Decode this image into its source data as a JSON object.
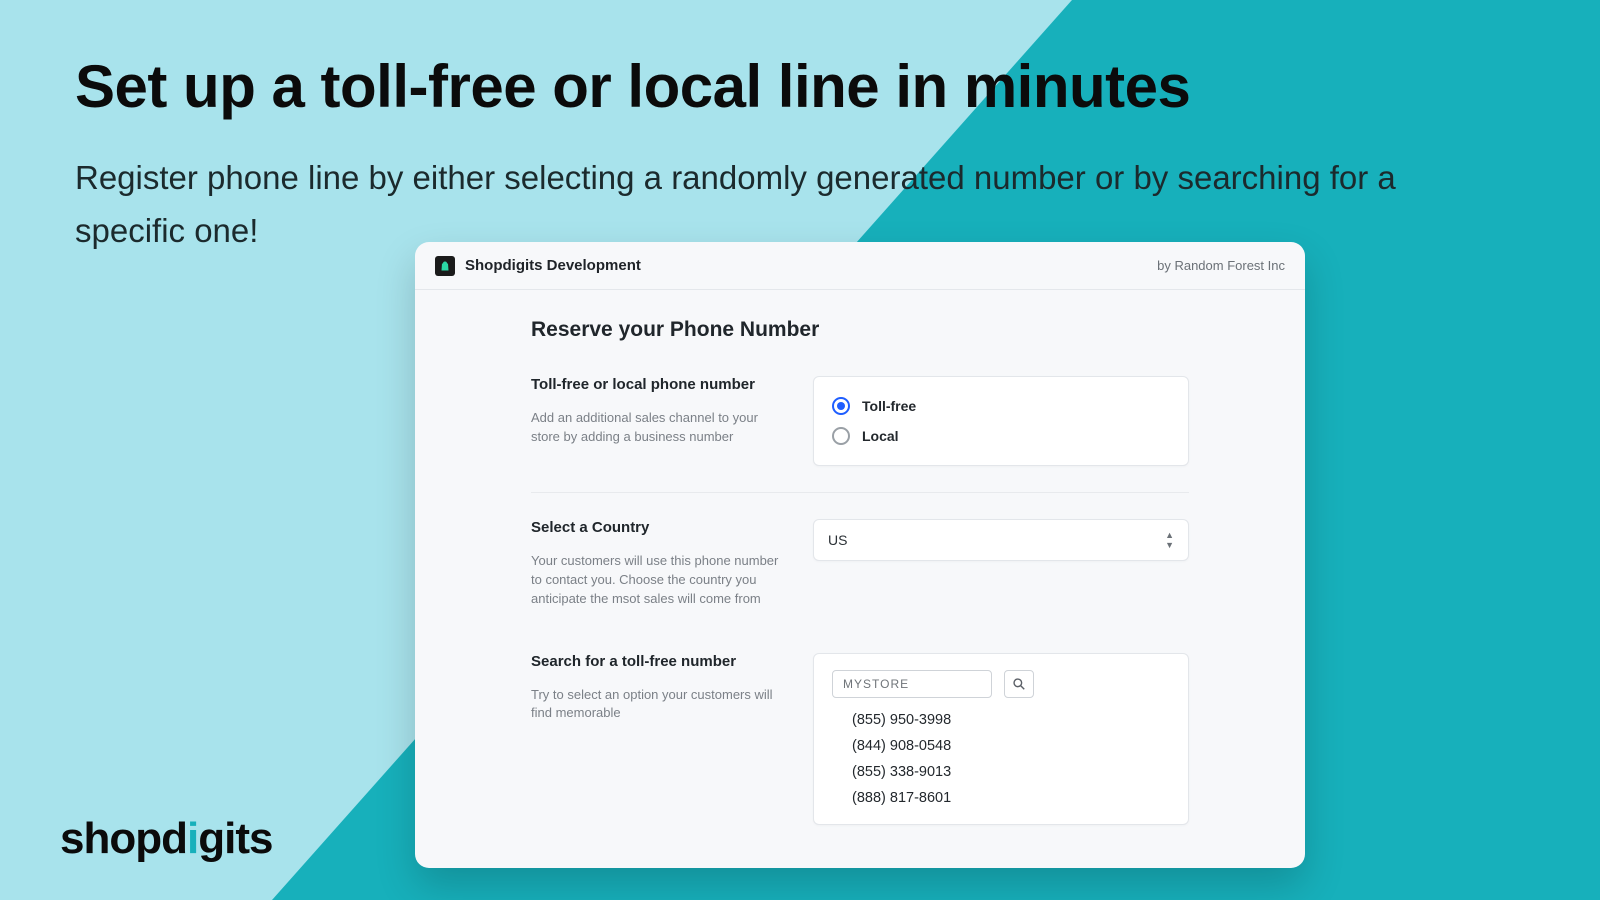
{
  "hero": {
    "headline": "Set up a toll-free or local line in minutes",
    "subhead": "Register phone line by either selecting a randomly generated number or by searching for a specific one!"
  },
  "brand": {
    "pre": "shopd",
    "accent": "i",
    "post": "gits"
  },
  "panel": {
    "app_title": "Shopdigits Development",
    "by_line": "by Random Forest Inc",
    "page_title": "Reserve your Phone Number",
    "type_section": {
      "title": "Toll-free or local phone number",
      "desc": "Add an additional sales channel to your store by adding a business number",
      "options": {
        "toll_free": "Toll-free",
        "local": "Local"
      }
    },
    "country_section": {
      "title": "Select a Country",
      "desc": "Your customers will use this phone number to contact you. Choose the country you anticipate the msot sales will come from",
      "value": "US"
    },
    "search_section": {
      "title": "Search for a toll-free number",
      "desc": "Try to select an option your customers will find memorable",
      "input_value": "MYSTORE",
      "results": [
        "(855) 950-3998",
        "(844) 908-0548",
        "(855) 338-9013",
        "(888) 817-8601"
      ]
    }
  }
}
